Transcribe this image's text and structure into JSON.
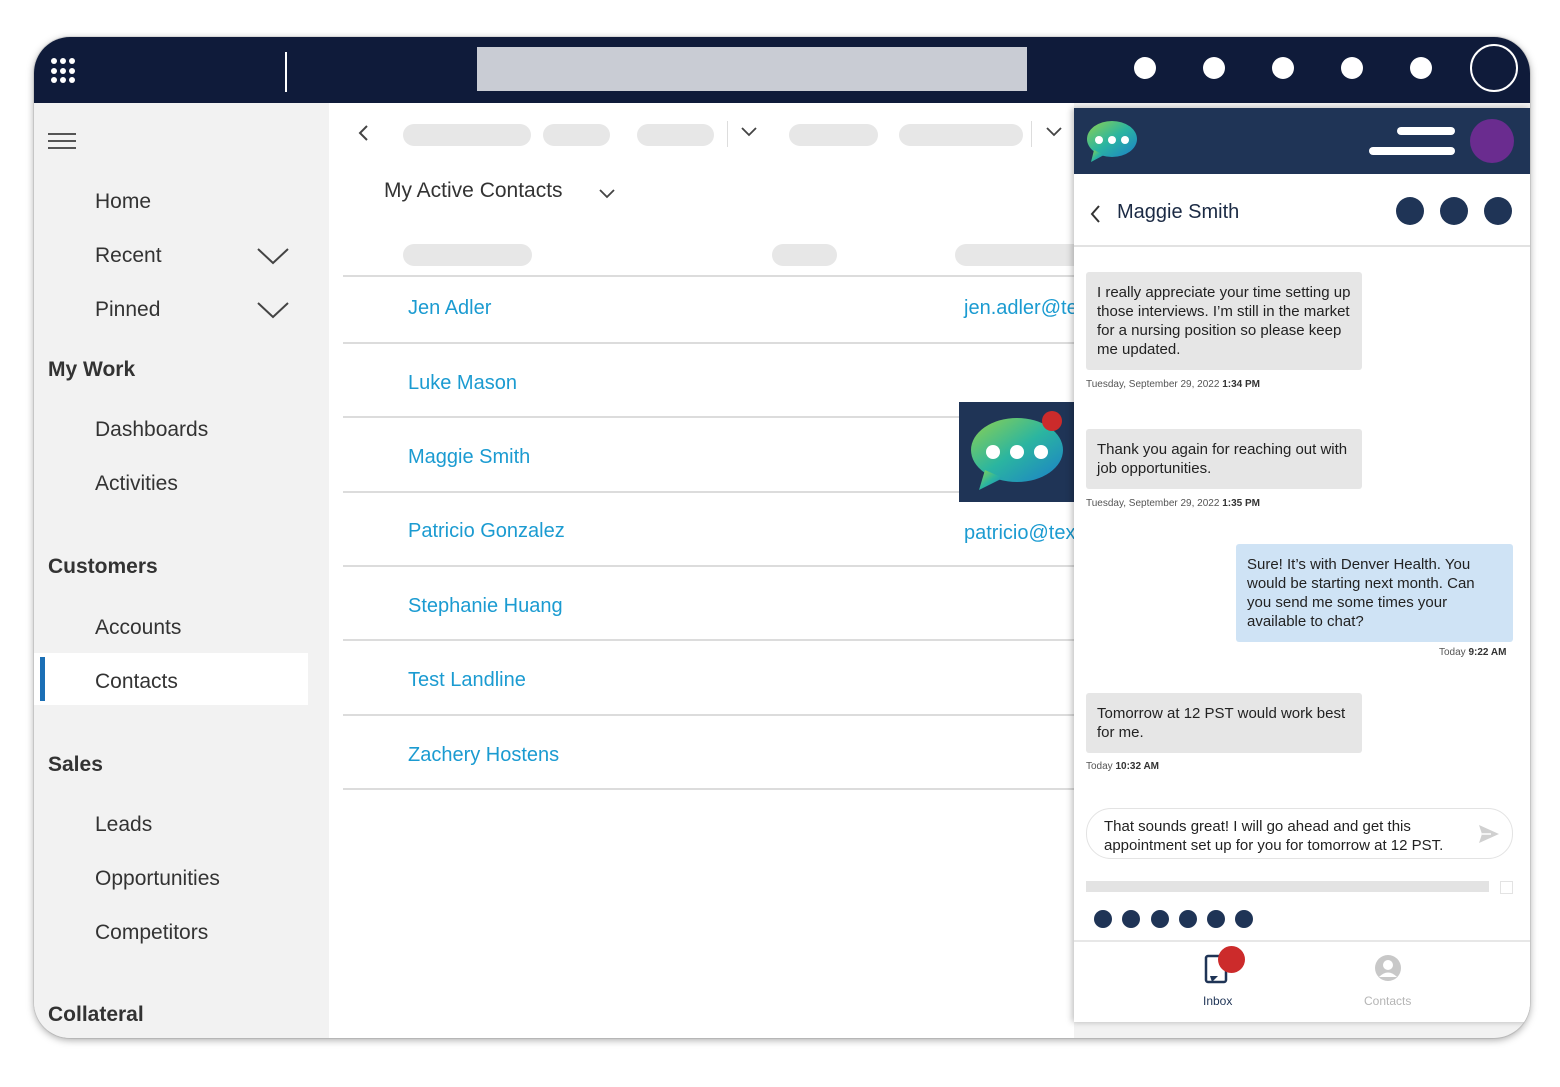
{
  "sidebar": {
    "items": [
      {
        "label": "Home"
      },
      {
        "label": "Recent"
      },
      {
        "label": "Pinned"
      }
    ],
    "sections": [
      {
        "title": "My Work",
        "items": [
          "Dashboards",
          "Activities"
        ]
      },
      {
        "title": "Customers",
        "items": [
          "Accounts",
          "Contacts"
        ]
      },
      {
        "title": "Sales",
        "items": [
          "Leads",
          "Opportunities",
          "Competitors"
        ]
      },
      {
        "title": "Collateral"
      }
    ],
    "active_item": "Contacts"
  },
  "main": {
    "view_title": "My Active Contacts",
    "contacts": [
      {
        "name": "Jen Adler",
        "email": "jen.adler@te"
      },
      {
        "name": "Luke Mason",
        "email": ""
      },
      {
        "name": "Maggie Smith",
        "email": ""
      },
      {
        "name": "Patricio Gonzalez",
        "email": "patricio@tex"
      },
      {
        "name": "Stephanie Huang",
        "email": ""
      },
      {
        "name": "Test Landline",
        "email": ""
      },
      {
        "name": "Zachery Hostens",
        "email": ""
      }
    ]
  },
  "chat": {
    "contact_name": "Maggie Smith",
    "messages": [
      {
        "direction": "in",
        "text": "I really appreciate your time setting up those interviews. I’m still in the market for a nursing position so please keep me updated.",
        "date": "Tuesday, September 29, 2022",
        "time": "1:34 PM"
      },
      {
        "direction": "in",
        "text": "Thank you again for reaching out with job opportunities.",
        "date": "Tuesday, September 29, 2022",
        "time": "1:35 PM"
      },
      {
        "direction": "out",
        "text": "Sure! It’s with Denver Health. You would be starting next month. Can you send me some times your available to chat?",
        "date": "Today",
        "time": "9:22 AM"
      },
      {
        "direction": "in",
        "text": "Tomorrow at 12 PST would work best for me.",
        "date": "Today",
        "time": "10:32 AM"
      }
    ],
    "composer_text": "That sounds great! I will go ahead and get this appointment set up for you for tomorrow at 12 PST.",
    "tabs": [
      {
        "label": "Inbox",
        "active": true
      },
      {
        "label": "Contacts",
        "active": false
      }
    ]
  },
  "colors": {
    "topbar": "#0f1b3a",
    "panel_header": "#1f3456",
    "link": "#1b9bd1",
    "accent": "#1b6fb5",
    "notification": "#cc2b2b",
    "user_avatar": "#6a2c8f"
  },
  "icons": [
    "app-launcher-icon",
    "menu-icon",
    "back-chevron-icon",
    "chevron-down-icon",
    "chat-bubble-icon",
    "send-icon",
    "inbox-icon",
    "contacts-person-icon"
  ]
}
